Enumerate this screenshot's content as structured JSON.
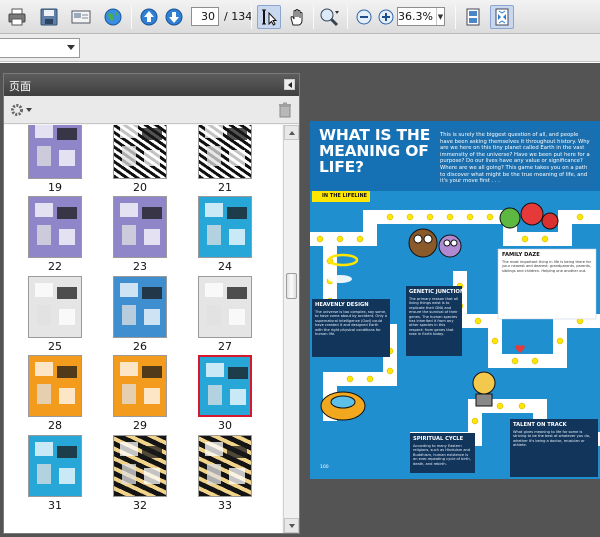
{
  "toolbar": {
    "current_page": "30",
    "total_pages": "/ 134",
    "zoom_level": "36.3%"
  },
  "panel": {
    "title": "页面"
  },
  "thumbnails": [
    {
      "label": "19",
      "style": "t-purple"
    },
    {
      "label": "20",
      "style": "t-bw"
    },
    {
      "label": "21",
      "style": "t-bw"
    },
    {
      "label": "22",
      "style": "t-purple"
    },
    {
      "label": "23",
      "style": "t-purple"
    },
    {
      "label": "24",
      "style": "t-cyan"
    },
    {
      "label": "25",
      "style": "t-gray"
    },
    {
      "label": "26",
      "style": "t-blue"
    },
    {
      "label": "27",
      "style": "t-gray"
    },
    {
      "label": "28",
      "style": "t-orange"
    },
    {
      "label": "29",
      "style": "t-orange"
    },
    {
      "label": "30",
      "style": "t-cyan",
      "selected": true
    },
    {
      "label": "31",
      "style": "t-cyan"
    },
    {
      "label": "32",
      "style": "t-zebra"
    },
    {
      "label": "33",
      "style": "t-zebra"
    }
  ],
  "document": {
    "title": "WHAT IS THE MEANING OF LIFE?",
    "intro": "This is surely the biggest question of all, and people have been asking themselves it throughout history. Why are we here on this tiny planet called Earth in the vast immensity of the universe? Have we been put here for a purpose? Do our lives have any value or significance? Where are we all going? This game takes you on a path to discover what might be the true meaning of life, and it's your move first . . .",
    "tag": "IN THE LIFELINE",
    "boxes": [
      {
        "title": "HEAVENLY DESIGN",
        "text": "The universe is too complex, say some, to have come about by accident. Only a supernatural intelligence (God) could have created it and designed Earth with the right physical conditions for human life."
      },
      {
        "title": "GENETIC JUNCTION",
        "text": "The primary reason that all living things exist is to replicate their DNA and ensure the survival of their genes. The human species has inherited it from any other species in this respect: from genes that rose in Earth today."
      },
      {
        "title": "FAMILY DAZE",
        "text": "The most important thing in life is being there for your nearest and dearest: grandparents, parents, siblings and children. Helping one another out."
      },
      {
        "title": "SPIRITUAL CYCLE",
        "text": "According to many Eastern religions, such as Hinduism and Buddhism, human existence is an ever-repeating cycle of birth, death, and rebirth."
      },
      {
        "title": "TALENT ON TRACK",
        "text": "What gives meaning to life for some is striving to be the best at whatever you do, whether it's being a doctor, musician or athlete."
      }
    ],
    "page_number": "100"
  },
  "colors": {
    "accent_blue": "#1f8fd0",
    "selection_red": "#d8162c",
    "dark_panel": "#545454"
  }
}
